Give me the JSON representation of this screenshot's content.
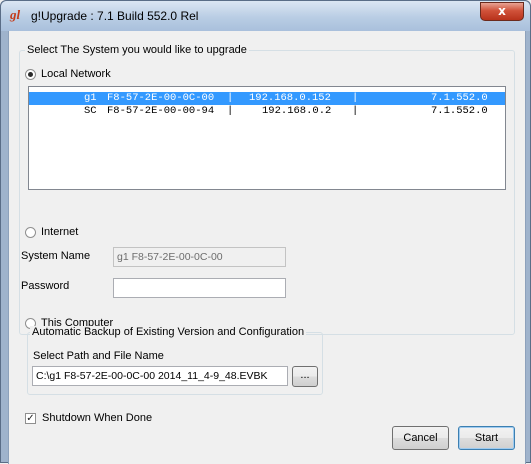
{
  "window": {
    "app_icon": "gl",
    "title": "g!Upgrade : 7.1 Build 552.0 Rel",
    "close_glyph": "x"
  },
  "select_group": {
    "legend": "Select The System you would like to upgrade",
    "local_network": {
      "label": "Local Network",
      "selected": true
    },
    "systems": [
      {
        "prefix": "g1",
        "mac": "F8-57-2E-00-0C-00",
        "sep1": "|",
        "ip": "192.168.0.152",
        "sep2": "|",
        "version": "7.1.552.0",
        "selected": true
      },
      {
        "prefix": "SC",
        "mac": "F8-57-2E-00-00-94",
        "sep1": "|",
        "ip": "192.168.0.2",
        "sep2": "|",
        "version": "7.1.552.0",
        "selected": false
      }
    ],
    "internet": {
      "label": "Internet",
      "selected": false
    },
    "system_name": {
      "label": "System Name",
      "value": "g1 F8-57-2E-00-0C-00"
    },
    "password": {
      "label": "Password",
      "value": ""
    },
    "this_computer": {
      "label": "This Computer",
      "selected": false
    }
  },
  "backup_group": {
    "legend": "Automatic Backup of Existing Version and Configuration",
    "path_label": "Select Path and File Name",
    "path_value": "C:\\g1 F8-57-2E-00-0C-00 2014_11_4-9_48.EVBK",
    "browse_label": "..."
  },
  "shutdown": {
    "label": "Shutdown When Done",
    "checked": true,
    "check_glyph": "✓"
  },
  "buttons": {
    "cancel": "Cancel",
    "start": "Start"
  }
}
